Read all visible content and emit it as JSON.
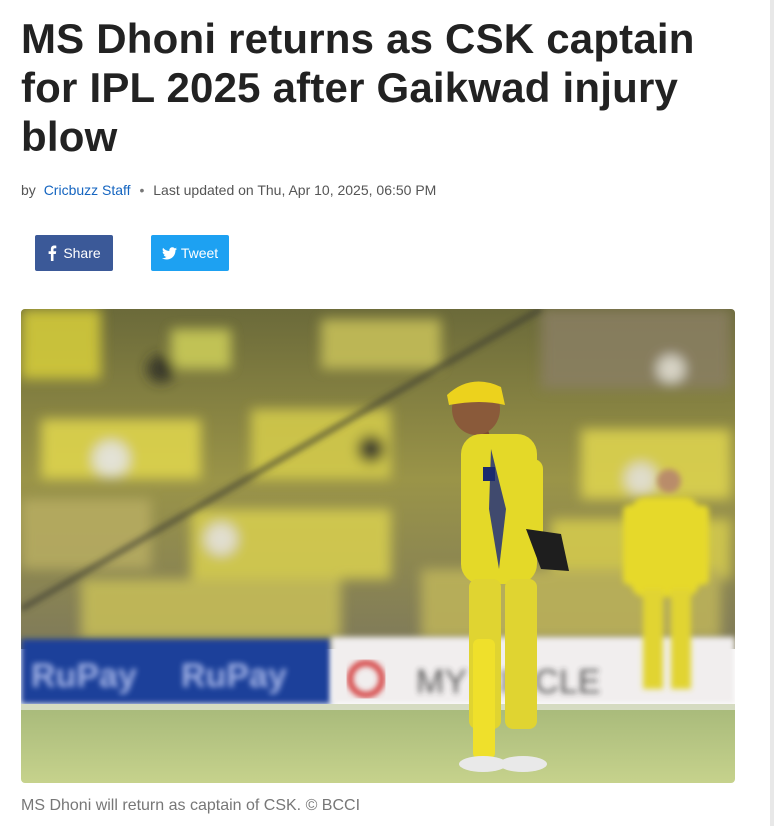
{
  "article": {
    "headline": "MS Dhoni returns as CSK captain for IPL 2025 after Gaikwad injury blow",
    "byline": {
      "prefix": "by",
      "author": "Cricbuzz Staff",
      "separator": "•",
      "updated": "Last updated on Thu, Apr 10, 2025, 06:50 PM"
    },
    "share": {
      "facebook_label": "Share",
      "twitter_label": "Tweet"
    },
    "image": {
      "banner_left": "RuPay",
      "banner_right": "MY CIRCLE"
    },
    "caption": "MS Dhoni will return as captain of CSK. © BCCI"
  },
  "colors": {
    "facebook": "#3b5998",
    "twitter": "#1da1f2",
    "author_link": "#1565c0",
    "jersey": "#e6d92a"
  },
  "icons": [
    "facebook-icon",
    "twitter-icon"
  ]
}
